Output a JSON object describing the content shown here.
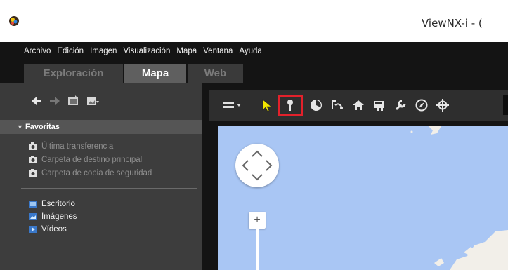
{
  "window": {
    "title": "ViewNX-i - ("
  },
  "menu": {
    "items": [
      "Archivo",
      "Edición",
      "Imagen",
      "Visualización",
      "Mapa",
      "Ventana",
      "Ayuda"
    ]
  },
  "tabs": [
    {
      "label": "Exploración",
      "active": false
    },
    {
      "label": "Mapa",
      "active": true
    },
    {
      "label": "Web",
      "active": false
    }
  ],
  "left_toolbar": {
    "icons": [
      "back-arrow-icon",
      "forward-arrow-icon",
      "folder-photo-icon",
      "photo-dropdown-icon"
    ]
  },
  "favorites": {
    "header": "Favoritas",
    "items": [
      "Última transferencia",
      "Carpeta de destino principal",
      "Carpeta de copia de seguridad"
    ]
  },
  "places": {
    "items": [
      "Escritorio",
      "Imágenes",
      "Vídeos"
    ]
  },
  "map_toolbar": {
    "tools": [
      "map-type-dropdown-icon",
      "select-arrow-icon",
      "pin-icon",
      "geotag-icon",
      "track-log-icon",
      "home-icon",
      "folder-map-icon",
      "wrench-icon",
      "compass-icon",
      "crosshair-icon"
    ],
    "selected_tool": "pin-icon",
    "highlight_color": "#e3212b"
  },
  "map": {
    "water_color": "#a9c6f4",
    "zoom_in_label": "+"
  },
  "colors": {
    "menubar": "#141414",
    "panel": "#3d3d3d",
    "active_tab": "#5f5f5f"
  }
}
